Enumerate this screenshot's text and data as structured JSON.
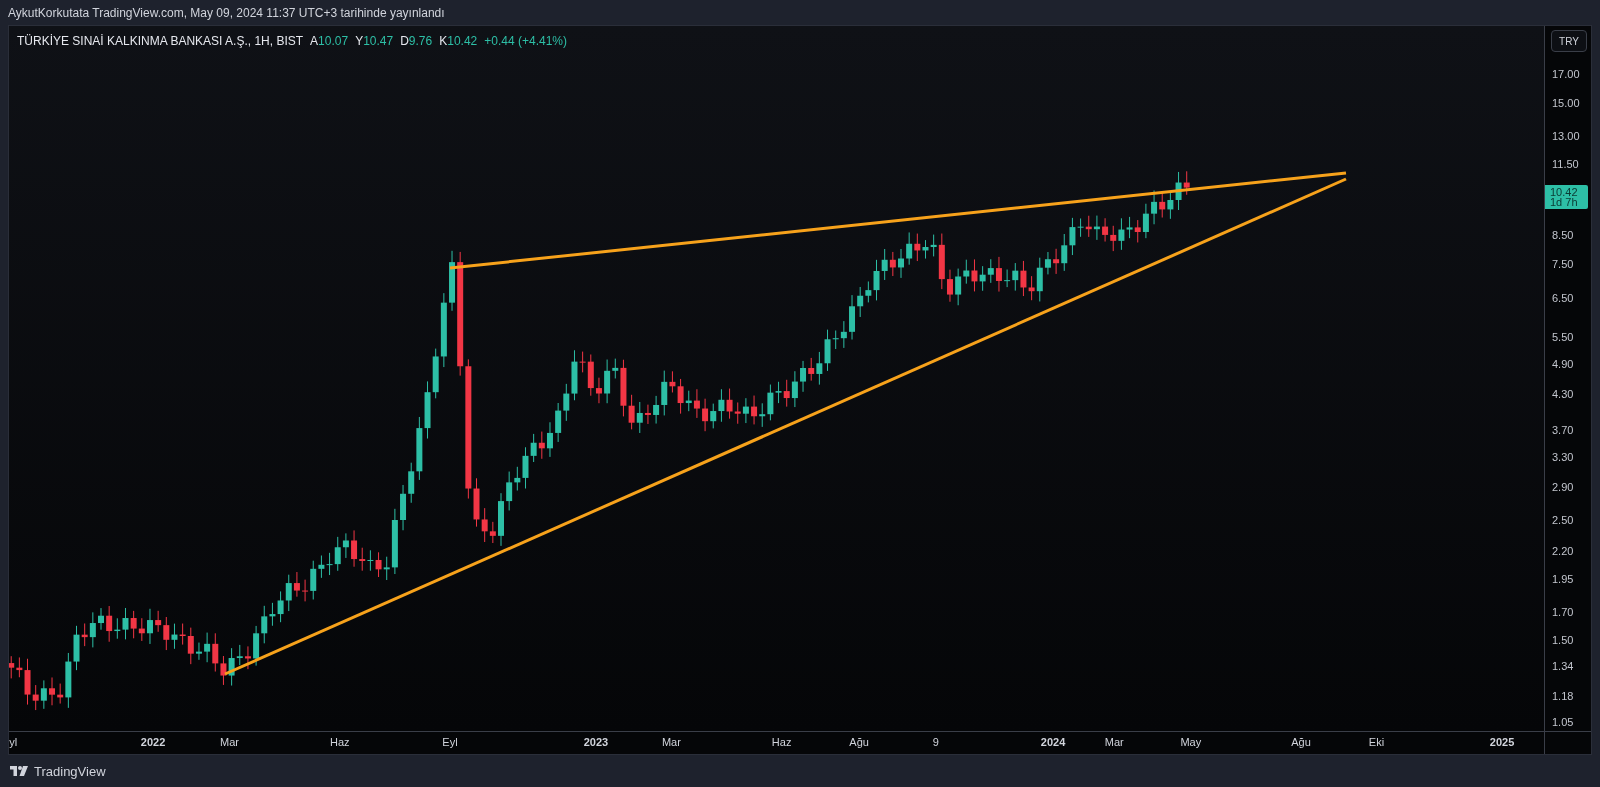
{
  "publish_note": "AykutKorkutata TradingView.com, May 09, 2024 11:37 UTC+3 tarihinde yayınlandı",
  "legend": {
    "symbol": "TÜRKİYE SINAİ KALKINMA BANKASI A.Ş., 1H, BIST",
    "values": [
      {
        "label": "A",
        "value": "10.07"
      },
      {
        "label": "Y",
        "value": "10.47"
      },
      {
        "label": "D",
        "value": "9.76"
      },
      {
        "label": "K",
        "value": "10.42"
      }
    ],
    "change": "+0.44 (+4.41%)"
  },
  "currency_button": "TRY",
  "price_axis": [
    "17.00",
    "15.00",
    "13.00",
    "11.50",
    "8.50",
    "7.50",
    "6.50",
    "5.50",
    "4.90",
    "4.30",
    "3.70",
    "3.30",
    "2.90",
    "2.50",
    "2.20",
    "1.95",
    "1.70",
    "1.50",
    "1.34",
    "1.18",
    "1.05"
  ],
  "price_tag": {
    "price": "10.42",
    "countdown": "1d 7h"
  },
  "time_axis": [
    {
      "label": "yl",
      "kind": "month"
    },
    {
      "label": "2022",
      "kind": "year"
    },
    {
      "label": "Mar",
      "kind": "month"
    },
    {
      "label": "Haz",
      "kind": "month"
    },
    {
      "label": "Eyl",
      "kind": "month"
    },
    {
      "label": "2023",
      "kind": "year"
    },
    {
      "label": "Mar",
      "kind": "month"
    },
    {
      "label": "Haz",
      "kind": "month"
    },
    {
      "label": "Ağu",
      "kind": "month"
    },
    {
      "label": "9",
      "kind": "month"
    },
    {
      "label": "2024",
      "kind": "year"
    },
    {
      "label": "Mar",
      "kind": "month"
    },
    {
      "label": "May",
      "kind": "month"
    },
    {
      "label": "Ağu",
      "kind": "month"
    },
    {
      "label": "Eki",
      "kind": "month"
    },
    {
      "label": "2025",
      "kind": "year"
    }
  ],
  "footer": {
    "brand": "TradingView"
  }
}
